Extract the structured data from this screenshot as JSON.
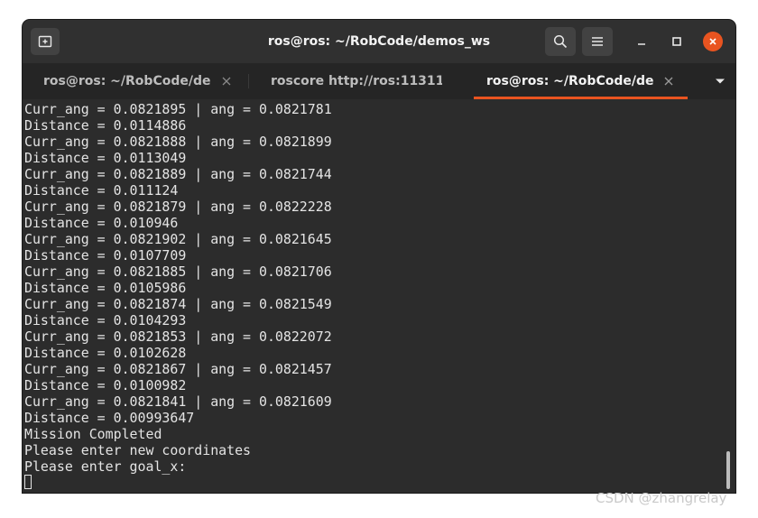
{
  "window": {
    "title": "ros@ros: ~/RobCode/demos_ws"
  },
  "titlebar": {
    "new_tab_icon": "new-tab-icon",
    "search_icon": "search-icon",
    "menu_icon": "hamburger-menu-icon",
    "minimize_icon": "minimize-icon",
    "maximize_icon": "maximize-icon",
    "close_icon": "close-icon",
    "close_color": "#e95420"
  },
  "tabs": [
    {
      "label": "ros@ros: ~/RobCode/de...",
      "active": false
    },
    {
      "label": "roscore http://ros:11311/",
      "active": false
    },
    {
      "label": "ros@ros: ~/RobCode/de...",
      "active": true
    }
  ],
  "tabs_menu_icon": "chevron-down-icon",
  "accent_color": "#e95420",
  "terminal": {
    "lines": [
      "Curr_ang = 0.0821895 | ang = 0.0821781",
      "Distance = 0.0114886",
      "Curr_ang = 0.0821888 | ang = 0.0821899",
      "Distance = 0.0113049",
      "Curr_ang = 0.0821889 | ang = 0.0821744",
      "Distance = 0.011124",
      "Curr_ang = 0.0821879 | ang = 0.0822228",
      "Distance = 0.010946",
      "Curr_ang = 0.0821902 | ang = 0.0821645",
      "Distance = 0.0107709",
      "Curr_ang = 0.0821885 | ang = 0.0821706",
      "Distance = 0.0105986",
      "Curr_ang = 0.0821874 | ang = 0.0821549",
      "Distance = 0.0104293",
      "Curr_ang = 0.0821853 | ang = 0.0822072",
      "Distance = 0.0102628",
      "Curr_ang = 0.0821867 | ang = 0.0821457",
      "Distance = 0.0100982",
      "Curr_ang = 0.0821841 | ang = 0.0821609",
      "Distance = 0.00993647",
      "Mission Completed",
      "Please enter new coordinates",
      "Please enter goal_x:"
    ]
  },
  "watermark": "CSDN @zhangrelay"
}
